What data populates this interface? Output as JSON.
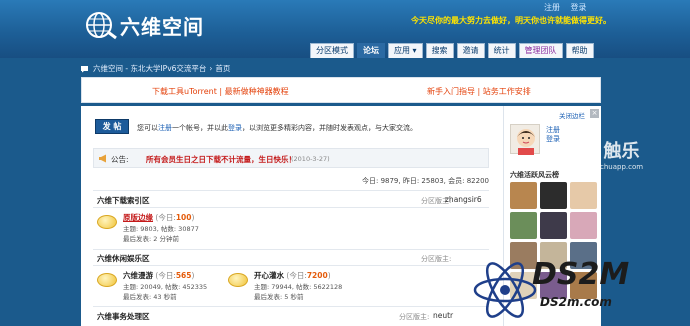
{
  "header": {
    "site_name": "六维空间",
    "top_links": [
      "注册",
      "登录"
    ],
    "slogan": "今天尽你的最大努力去做好，明天你也许就能做得更好。"
  },
  "nav": {
    "tabs": [
      {
        "label": "分区模式",
        "state": "normal"
      },
      {
        "label": "论坛",
        "state": "active"
      },
      {
        "label": "应用 ▾",
        "state": "normal"
      },
      {
        "label": "搜索",
        "state": "normal"
      },
      {
        "label": "邀请",
        "state": "normal"
      },
      {
        "label": "统计",
        "state": "normal"
      },
      {
        "label": "管理团队",
        "state": "purple"
      },
      {
        "label": "帮助",
        "state": "normal"
      }
    ]
  },
  "breadcrumb": [
    "六维空间 - 东北大学IPv6交流平台",
    "首页"
  ],
  "ads": {
    "left": "下载工具uTorrent | 最新做种神器教程",
    "right": "新手入门指导 | 站务工作安排"
  },
  "post_button": "发 帖",
  "intro": {
    "before": "您可以",
    "register": "注册",
    "middle": "一个帐号，并以此",
    "login": "登录",
    "after": "，以浏览更多精彩内容，并随时发表观点，与大家交流。"
  },
  "notice": {
    "label": "公告:",
    "text": "所有会员生日之日下载不计流量，生日快乐！",
    "date": "(2010-3-27)"
  },
  "stats": "今日: 9879, 昨日: 25803, 会员: 82200",
  "sections": [
    {
      "title": "六维下载索引区",
      "moderator_label": "分区版主:",
      "moderator": "zhangsir6",
      "forums": [
        {
          "name": "原版边缘",
          "today_label": "(今日:",
          "today": "100",
          "today_close": ")",
          "meta": "主题: 9803, 帖数: 30877",
          "last": "最后发表: 2 分钟前"
        }
      ]
    },
    {
      "title": "六维休闲娱乐区",
      "moderator_label": "分区版主:",
      "moderator": "",
      "forums": [
        {
          "name": "六维漫游",
          "today_label": "(今日:",
          "today": "565",
          "today_close": ")",
          "meta": "主题: 20049, 帖数: 452335",
          "last": "最后发表: 43 秒前"
        },
        {
          "name": "开心灌水",
          "today_label": "(今日:",
          "today": "7200",
          "today_close": ")",
          "meta": "主题: 79944, 帖数: 5622128",
          "last": "最后发表: 5 秒前"
        }
      ]
    },
    {
      "title": "六维事务处理区",
      "moderator_label": "分区版主:",
      "moderator": "neutr"
    }
  ],
  "sidebar": {
    "close_label": "关闭边栏",
    "links": [
      "注册",
      "登录"
    ],
    "fans_title": "六维活跃风云榜"
  },
  "watermarks": {
    "chuapp_big": "触乐",
    "chuapp_small": "chuapp.com",
    "ds2m_big": "DS2M",
    "ds2m_url": "DS2m.com"
  }
}
